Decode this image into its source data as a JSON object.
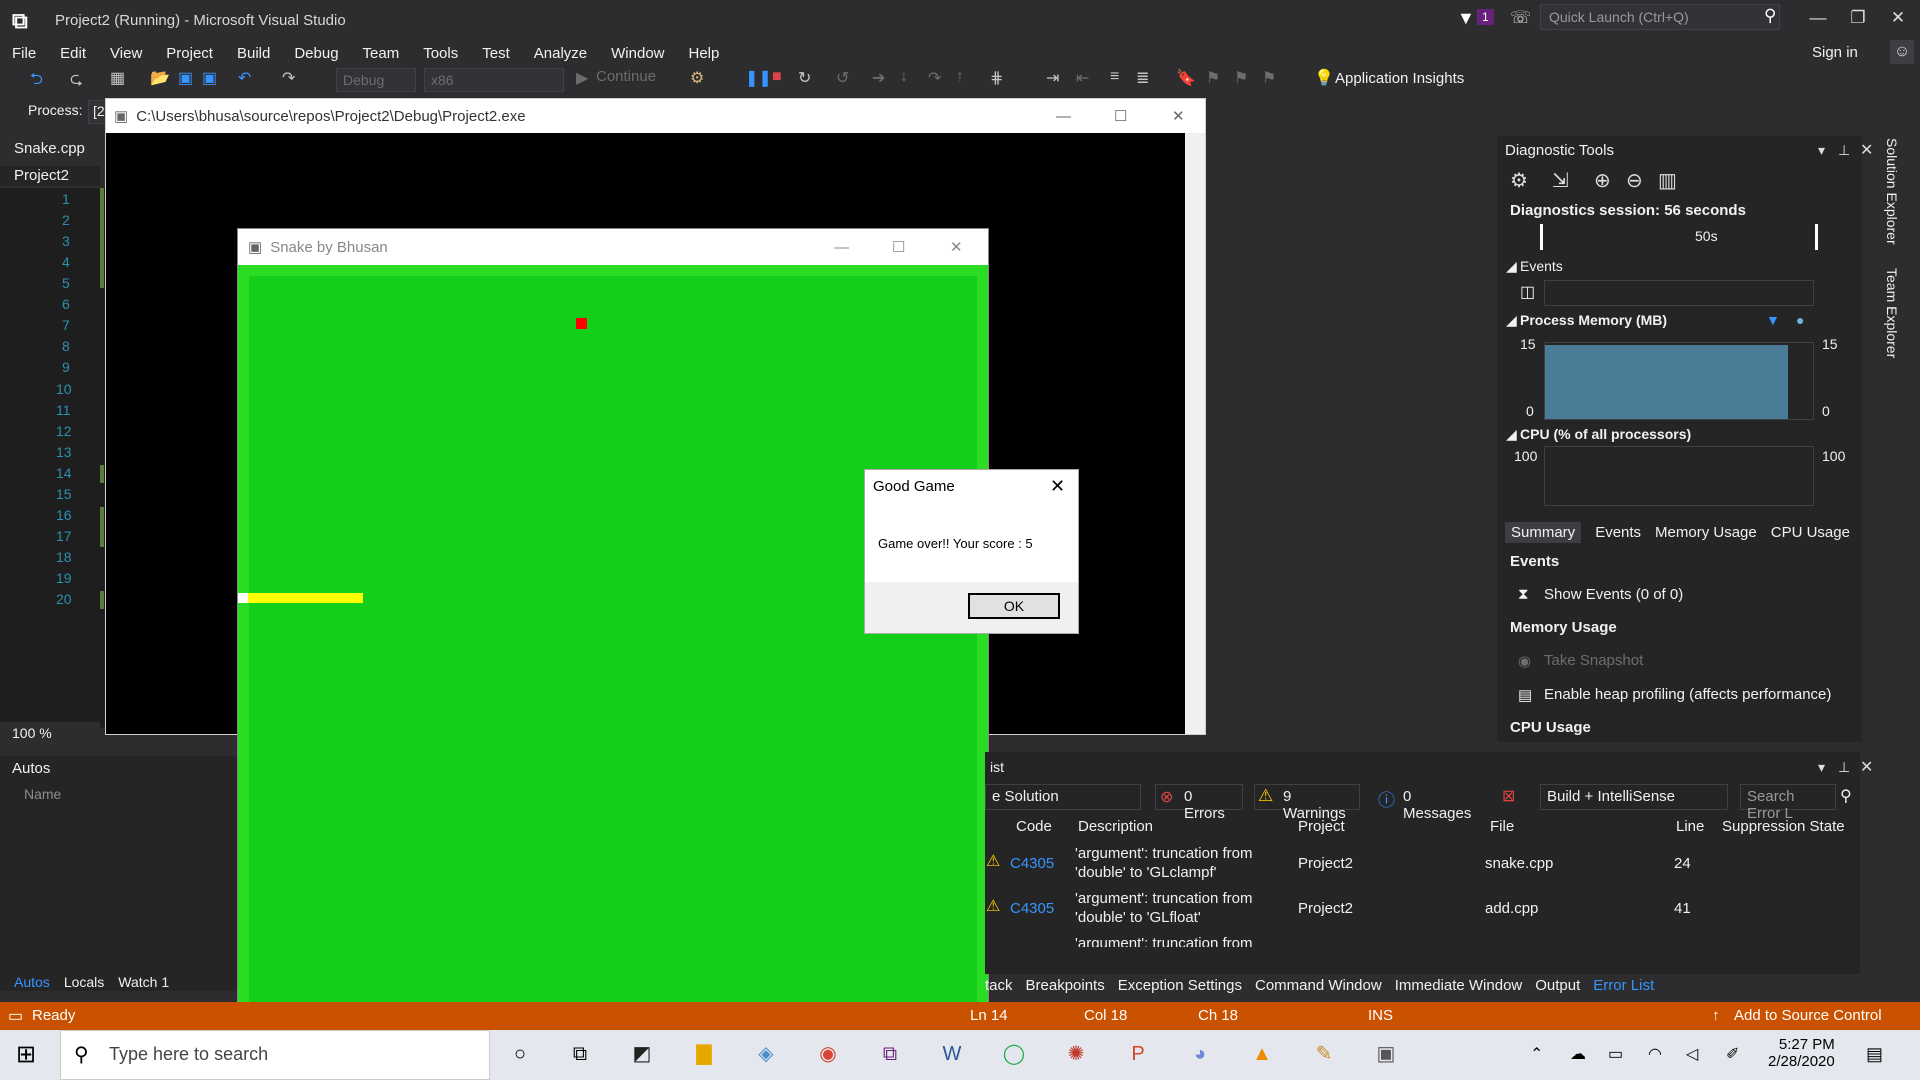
{
  "window": {
    "title": "Project2 (Running) - Microsoft Visual Studio",
    "notification_count": "1",
    "quick_launch_placeholder": "Quick Launch (Ctrl+Q)",
    "sign_in": "Sign in"
  },
  "menu": [
    "File",
    "Edit",
    "View",
    "Project",
    "Build",
    "Debug",
    "Team",
    "Tools",
    "Test",
    "Analyze",
    "Window",
    "Help"
  ],
  "toolbar": {
    "config": "Debug",
    "platform": "x86",
    "continue": "Continue",
    "app_insights": "Application Insights"
  },
  "process": {
    "label": "Process:",
    "value": "[2"
  },
  "editor": {
    "tab": "Snake.cpp",
    "project": "Project2",
    "line_numbers": [
      "1",
      "2",
      "3",
      "4",
      "5",
      "6",
      "7",
      "8",
      "9",
      "10",
      "11",
      "12",
      "13",
      "14",
      "15",
      "16",
      "17",
      "18",
      "19",
      "20"
    ],
    "zoom": "100 %"
  },
  "autos": {
    "header": "Autos",
    "column": "Name",
    "tabs": [
      "Autos",
      "Locals",
      "Watch 1"
    ]
  },
  "console": {
    "title": "C:\\Users\\bhusa\\source\\repos\\Project2\\Debug\\Project2.exe"
  },
  "snake_window": {
    "title": "Snake by Bhusan"
  },
  "dialog": {
    "title": "Good Game",
    "message": "Game over!! Your score : 5",
    "ok": "OK"
  },
  "diagnostics": {
    "header": "Diagnostic Tools",
    "session": "Diagnostics session: 56 seconds",
    "timeline_label": "50s",
    "events_label": "Events",
    "memory_label": "Process Memory (MB)",
    "memory_max": "15",
    "memory_min": "0",
    "cpu_label": "CPU (% of all processors)",
    "cpu_max": "100",
    "tabs": [
      "Summary",
      "Events",
      "Memory Usage",
      "CPU Usage"
    ],
    "events_section": "Events",
    "show_events": "Show Events (0 of 0)",
    "memory_section": "Memory Usage",
    "take_snapshot": "Take Snapshot",
    "heap_profiling": "Enable heap profiling (affects performance)",
    "cpu_section": "CPU Usage"
  },
  "error_list": {
    "header": "ist",
    "scope": "e Solution",
    "errors": "0 Errors",
    "warnings": "9 Warnings",
    "messages": "0 Messages",
    "build_filter": "Build + IntelliSense",
    "search_placeholder": "Search Error L",
    "columns": [
      "Code",
      "Description",
      "Project",
      "File",
      "Line",
      "Suppression State"
    ],
    "rows": [
      {
        "code": "C4305",
        "desc1": "'argument': truncation from",
        "desc2": "'double' to 'GLclampf'",
        "project": "Project2",
        "file": "snake.cpp",
        "line": "24"
      },
      {
        "code": "C4305",
        "desc1": "'argument': truncation from",
        "desc2": "'double' to 'GLfloat'",
        "project": "Project2",
        "file": "add.cpp",
        "line": "41"
      },
      {
        "code": "",
        "desc1": "'argument': truncation from",
        "desc2": "",
        "project": "",
        "file": "",
        "line": ""
      }
    ]
  },
  "bottom_tabs": [
    "tack",
    "Breakpoints",
    "Exception Settings",
    "Command Window",
    "Immediate Window",
    "Output",
    "Error List"
  ],
  "status": {
    "ready": "Ready",
    "ln": "Ln 14",
    "col": "Col 18",
    "ch": "Ch 18",
    "ins": "INS",
    "source_control": "Add to Source Control"
  },
  "side_tabs": [
    "Solution Explorer",
    "Team Explorer"
  ],
  "taskbar": {
    "search_placeholder": "Type here to search",
    "time": "5:27 PM",
    "date": "2/28/2020"
  },
  "colors": {
    "vs_bg": "#2d2d30",
    "status_orange": "#ca5100",
    "snake_green": "#14cf19",
    "snake_yellow": "#ffff00",
    "food_red": "#ff0000"
  }
}
